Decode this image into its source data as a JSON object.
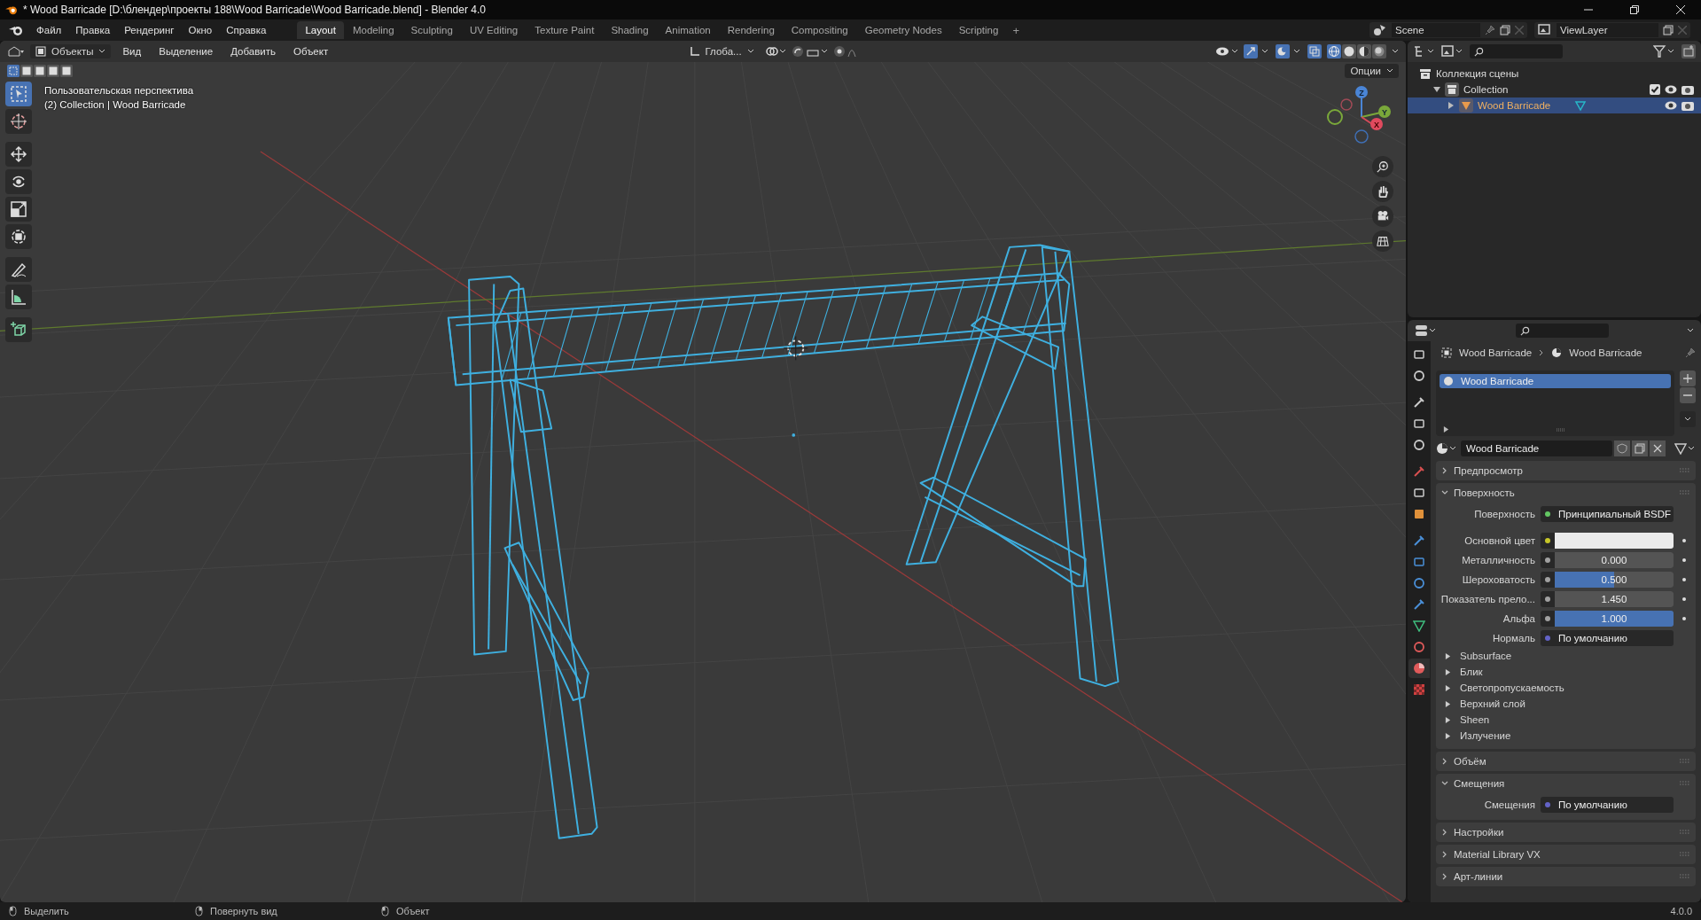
{
  "title_bar": {
    "title": "* Wood Barricade [D:\\блендер\\проекты 188\\Wood Barricade\\Wood Barricade.blend] - Blender 4.0"
  },
  "menu": [
    "Файл",
    "Правка",
    "Рендеринг",
    "Окно",
    "Справка"
  ],
  "workspaces": [
    {
      "label": "Layout",
      "selected": true
    },
    {
      "label": "Modeling",
      "selected": false
    },
    {
      "label": "Sculpting",
      "selected": false
    },
    {
      "label": "UV Editing",
      "selected": false
    },
    {
      "label": "Texture Paint",
      "selected": false
    },
    {
      "label": "Shading",
      "selected": false
    },
    {
      "label": "Animation",
      "selected": false
    },
    {
      "label": "Rendering",
      "selected": false
    },
    {
      "label": "Compositing",
      "selected": false
    },
    {
      "label": "Geometry Nodes",
      "selected": false
    },
    {
      "label": "Scripting",
      "selected": false
    }
  ],
  "add_workspace": "+",
  "scene": "Scene",
  "view_layer": "ViewLayer",
  "viewport": {
    "mode": "Объекты",
    "menus": [
      "Вид",
      "Выделение",
      "Добавить",
      "Объект"
    ],
    "orientation": "Глоба...",
    "options": "Опции",
    "info": [
      "Пользовательская перспектива",
      "(2) Collection | Wood Barricade"
    ],
    "select_modes": [
      {
        "selected": true
      },
      {
        "selected": false
      },
      {
        "selected": false
      },
      {
        "selected": false
      },
      {
        "selected": false
      }
    ],
    "shading": [
      {
        "selected": true
      },
      {
        "selected": false
      },
      {
        "selected": false
      },
      {
        "selected": false
      }
    ],
    "tools": [
      {
        "selected": true
      },
      {
        "selected": false
      },
      {
        "selected": false
      },
      {
        "selected": false
      },
      {
        "selected": false
      },
      {
        "selected": false
      },
      {
        "selected": false
      },
      {
        "selected": false
      },
      {
        "selected": false
      }
    ],
    "gizmo": [
      "Z",
      "Y",
      "X"
    ]
  },
  "outliner": {
    "tree": [
      {
        "label": "Коллекция сцены",
        "children": [
          {
            "label": "Collection",
            "expanded": true,
            "checked": true,
            "selected": false,
            "children": [
              {
                "label": "Wood Barricade",
                "expanded": false,
                "checked": false,
                "selected": true
              }
            ]
          }
        ]
      }
    ]
  },
  "properties": {
    "tabs": [
      {
        "selected": false
      },
      {
        "selected": false
      },
      {
        "selected": false
      },
      {
        "selected": false
      },
      {
        "selected": false
      },
      {
        "selected": false
      },
      {
        "selected": false
      },
      {
        "selected": false
      },
      {
        "selected": false
      },
      {
        "selected": false
      },
      {
        "selected": false
      },
      {
        "selected": false
      },
      {
        "selected": false
      },
      {
        "selected": false
      },
      {
        "selected": true
      },
      {
        "selected": false
      }
    ],
    "breadcrumb": [
      "Wood Barricade",
      "Wood Barricade"
    ],
    "slots": [
      {
        "label": "Wood Barricade",
        "selected": true
      }
    ],
    "material": "Wood Barricade",
    "panels": [
      {
        "title": "Предпросмотр",
        "expanded": false
      },
      {
        "title": "Поверхность",
        "expanded": true,
        "rows": [
          {
            "kind": "link",
            "label": "Поверхность",
            "value": "Принципиальный BSDF",
            "socket": {
              "color": "#63c763"
            }
          },
          {
            "kind": "color",
            "label": "Основной цвет",
            "swatch": {
              "color": "#ebebeb"
            },
            "socket": {
              "color": "#c7c729"
            }
          },
          {
            "kind": "slider",
            "label": "Металличность",
            "value": "0.000",
            "level": 0,
            "socket": {
              "color": "#a1a1a1"
            }
          },
          {
            "kind": "slider",
            "label": "Шероховатость",
            "value": "0.500",
            "level": 0.5,
            "socket": {
              "color": "#a1a1a1"
            }
          },
          {
            "kind": "number",
            "label": "Показатель прело...",
            "value": "1.450",
            "socket": {
              "color": "#a1a1a1"
            }
          },
          {
            "kind": "slider",
            "label": "Альфа",
            "value": "1.000",
            "level": 1,
            "socket": {
              "color": "#a1a1a1"
            }
          },
          {
            "kind": "link",
            "label": "Нормаль",
            "value": "По умолчанию",
            "socket": {
              "color": "#6363c7"
            }
          }
        ],
        "subpanels": [
          {
            "title": "Subsurface",
            "expanded": false
          },
          {
            "title": "Блик",
            "expanded": false
          },
          {
            "title": "Светопропускаемость",
            "expanded": false
          },
          {
            "title": "Верхний слой",
            "expanded": false
          },
          {
            "title": "Sheen",
            "expanded": false
          },
          {
            "title": "Излучение",
            "expanded": false
          }
        ]
      },
      {
        "title": "Объём",
        "expanded": false
      },
      {
        "title": "Смещения",
        "expanded": true,
        "rows": [
          {
            "kind": "link",
            "label": "Смещения",
            "value": "По умолчанию",
            "socket": {
              "color": "#6363c7"
            }
          }
        ]
      },
      {
        "title": "Настройки",
        "expanded": false
      },
      {
        "title": "Material Library VX",
        "expanded": false
      },
      {
        "title": "Арт-линии",
        "expanded": false
      }
    ]
  },
  "status_bar": {
    "items": [
      "Выделить",
      "Повернуть вид",
      "Объект"
    ],
    "version": "4.0.0"
  }
}
